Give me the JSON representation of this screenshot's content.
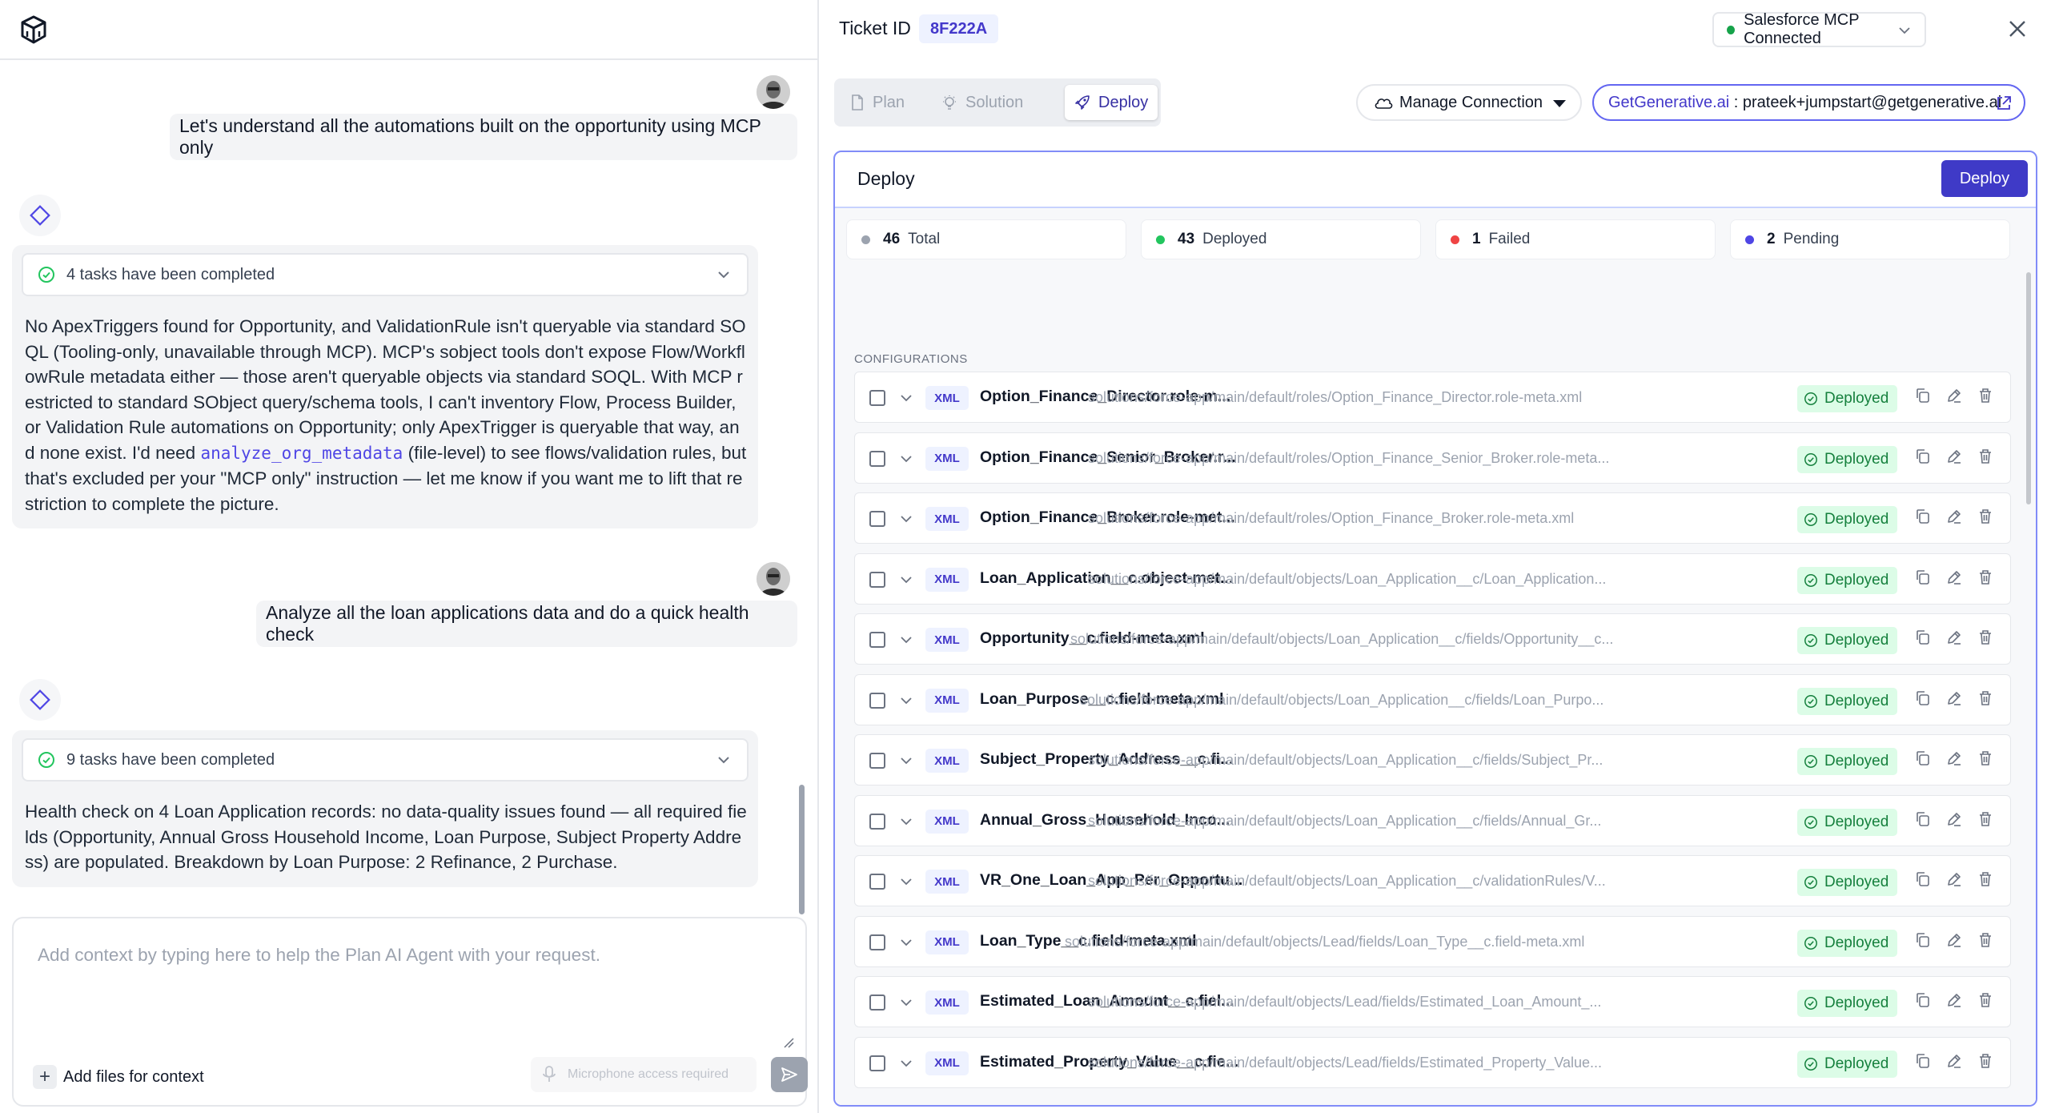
{
  "chat": {
    "messages": [
      {
        "role": "user",
        "text": "Let's understand all the automations built on the opportunity using MCP only"
      },
      {
        "role": "assistant",
        "tasks_label": "4 tasks have been completed",
        "text_before": "No ApexTriggers found for Opportunity, and ValidationRule isn't queryable via standard SOQL (Tooling-only, unavailable through MCP). MCP's sobject tools don't expose Flow/WorkflowRule metadata either — those aren't queryable objects via standard SOQL. With MCP restricted to standard SObject query/schema tools, I can't inventory Flow, Process Builder, or Validation Rule automations on Opportunity; only ApexTrigger is queryable that way, and none exist. I'd need ",
        "code": "analyze_org_metadata",
        "text_after": " (file-level) to see flows/validation rules, but that's excluded per your \"MCP only\" instruction — let me know if you want me to lift that restriction to complete the picture."
      },
      {
        "role": "user",
        "text": "Analyze all the loan applications data and do a quick health check"
      },
      {
        "role": "assistant",
        "tasks_label": "9 tasks have been completed",
        "text": "Health check on 4 Loan Application records: no data-quality issues found — all required fields (Opportunity, Annual Gross Household Income, Loan Purpose, Subject Property Address) are populated. Breakdown by Loan Purpose: 2 Refinance, 2 Purchase."
      }
    ]
  },
  "composer": {
    "placeholder": "Add context by typing here to help the Plan AI Agent with your request.",
    "add_files_label": "Add files for context",
    "mic_label": "Microphone access required"
  },
  "header": {
    "ticket_label": "Ticket ID",
    "ticket_id": "8F222A",
    "connection_status": "Salesforce MCP Connected"
  },
  "tabs": [
    {
      "label": "Plan",
      "active": false
    },
    {
      "label": "Solution",
      "active": false
    },
    {
      "label": "Deploy",
      "active": true
    }
  ],
  "connection": {
    "manage_label": "Manage Connection",
    "org_name": "GetGenerative.ai",
    "separator": " : ",
    "org_user": "prateek+jumpstart@getgenerative.ai"
  },
  "deploy": {
    "title": "Deploy",
    "button_label": "Deploy",
    "stats": [
      {
        "count": "46",
        "label": "Total",
        "color": "#9ca3af"
      },
      {
        "count": "43",
        "label": "Deployed",
        "color": "#22c55e"
      },
      {
        "count": "1",
        "label": "Failed",
        "color": "#ef4444"
      },
      {
        "count": "2",
        "label": "Pending",
        "color": "#4f46e5"
      }
    ],
    "section_label": "CONFIGURATIONS",
    "items": [
      {
        "type": "XML",
        "name": "Option_Finance_Director.role-m...",
        "path": "solutions/force-app/main/default/roles/Option_Finance_Director.role-meta.xml",
        "status": "Deployed"
      },
      {
        "type": "XML",
        "name": "Option_Finance_Senior_Broker.r...",
        "path": "solutions/force-app/main/default/roles/Option_Finance_Senior_Broker.role-meta...",
        "status": "Deployed"
      },
      {
        "type": "XML",
        "name": "Option_Finance_Broker.role-met...",
        "path": "solutions/force-app/main/default/roles/Option_Finance_Broker.role-meta.xml",
        "status": "Deployed"
      },
      {
        "type": "XML",
        "name": "Loan_Application__c.object-met...",
        "path": "solutions/force-app/main/default/objects/Loan_Application__c/Loan_Application...",
        "status": "Deployed"
      },
      {
        "type": "XML",
        "name": "Opportunity__c.field-meta.xml",
        "path": "solutions/force-app/main/default/objects/Loan_Application__c/fields/Opportunity__c...",
        "status": "Deployed"
      },
      {
        "type": "XML",
        "name": "Loan_Purpose__c.field-meta.xml",
        "path": "solutions/force-app/main/default/objects/Loan_Application__c/fields/Loan_Purpo...",
        "status": "Deployed"
      },
      {
        "type": "XML",
        "name": "Subject_Property_Address__c.fi...",
        "path": "solutions/force-app/main/default/objects/Loan_Application__c/fields/Subject_Pr...",
        "status": "Deployed"
      },
      {
        "type": "XML",
        "name": "Annual_Gross_Household_Inco...",
        "path": "solutions/force-app/main/default/objects/Loan_Application__c/fields/Annual_Gr...",
        "status": "Deployed"
      },
      {
        "type": "XML",
        "name": "VR_One_Loan_App_Per_Opportu...",
        "path": "solutions/force-app/main/default/objects/Loan_Application__c/validationRules/V...",
        "status": "Deployed"
      },
      {
        "type": "XML",
        "name": "Loan_Type__c.field-meta.xml",
        "path": "solutions/force-app/main/default/objects/Lead/fields/Loan_Type__c.field-meta.xml",
        "status": "Deployed"
      },
      {
        "type": "XML",
        "name": "Estimated_Loan_Amount__c.fiel...",
        "path": "solutions/force-app/main/default/objects/Lead/fields/Estimated_Loan_Amount_...",
        "status": "Deployed"
      },
      {
        "type": "XML",
        "name": "Estimated_Property_Value__c.fie...",
        "path": "solutions/force-app/main/default/objects/Lead/fields/Estimated_Property_Value...",
        "status": "Deployed"
      }
    ]
  }
}
